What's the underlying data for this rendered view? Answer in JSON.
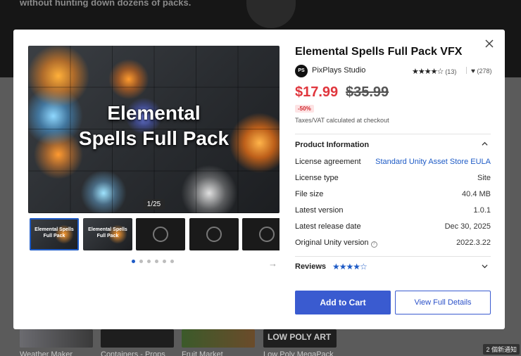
{
  "background": {
    "hero_text": "without hunting down dozens of packs.",
    "thumb_logo_text": "LOW POLY ART",
    "thumb_labels": [
      "Weather Maker",
      "Containers - Props",
      "Fruit Market",
      "Low Poly MegaPack"
    ],
    "notification": "2 個新通知"
  },
  "modal": {
    "title": "Elemental Spells Full Pack VFX",
    "publisher": {
      "logo": "PS",
      "name": "PixPlays Studio"
    },
    "rating": {
      "stars": "★★★★☆",
      "count": "(13)"
    },
    "favorites": "(278)",
    "price": {
      "sale": "$17.99",
      "original": "$35.99",
      "discount": "-50%"
    },
    "tax_note": "Taxes/VAT calculated at checkout",
    "gallery": {
      "image_title_line1": "Elemental",
      "image_title_line2": "Spells Full Pack",
      "counter": "1/25",
      "thumb_title": "Elemental Spells Full Pack"
    },
    "product_info": {
      "heading": "Product Information",
      "rows": [
        {
          "key": "License agreement",
          "value": "Standard Unity Asset Store EULA"
        },
        {
          "key": "License type",
          "value": "Site"
        },
        {
          "key": "File size",
          "value": "40.4 MB"
        },
        {
          "key": "Latest version",
          "value": "1.0.1"
        },
        {
          "key": "Latest release date",
          "value": "Dec 30, 2025"
        },
        {
          "key": "Original Unity version",
          "value": "2022.3.22"
        }
      ]
    },
    "reviews": {
      "heading": "Reviews",
      "stars": "★★★★☆"
    },
    "buttons": {
      "add_to_cart": "Add to Cart",
      "view_details": "View Full Details"
    }
  },
  "icons": [
    "close-icon",
    "chevron-up-icon",
    "chevron-down-icon",
    "heart-icon",
    "help-icon",
    "arrow-right-icon",
    "play-icon"
  ],
  "colors": {
    "accent": "#3a5bd0",
    "sale": "#e0363d",
    "link": "#1e5bc6"
  }
}
